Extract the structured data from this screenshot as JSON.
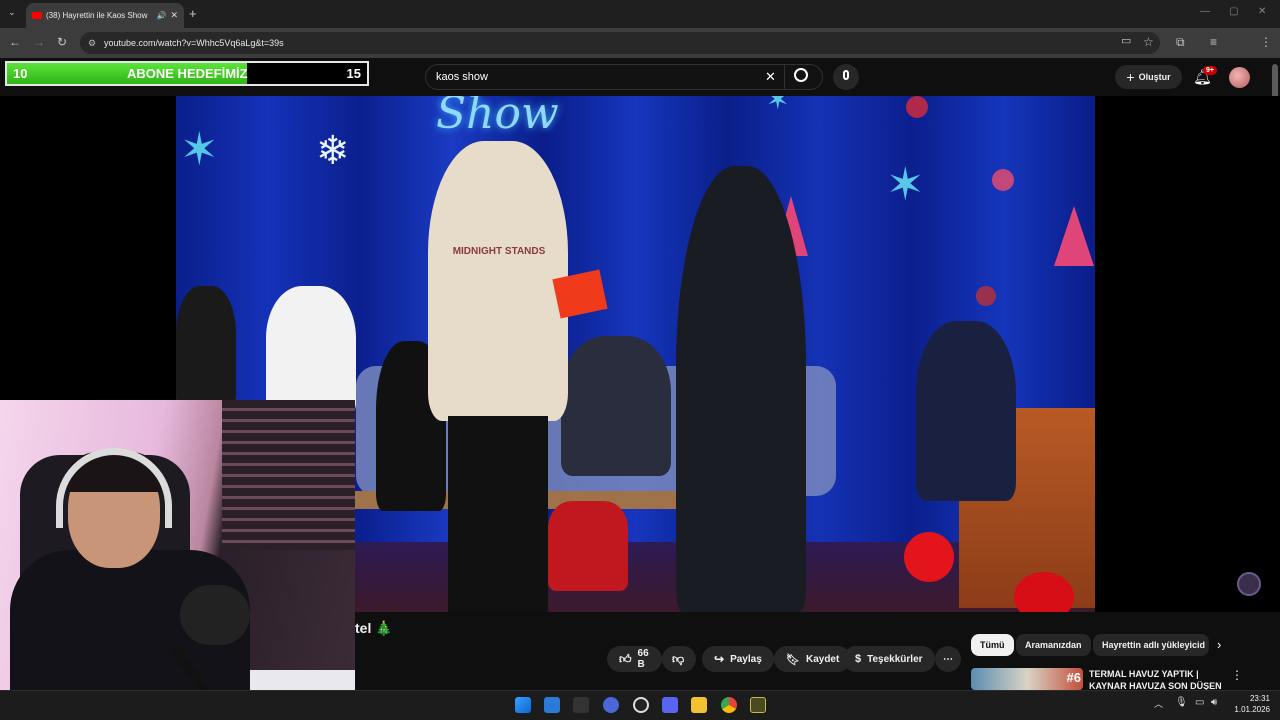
{
  "browser": {
    "tab_title": "(38) Hayrettin ile Kaos Show",
    "url": "youtube.com/watch?v=Whhc5Vq6aLg&t=39s",
    "new_tab_glyph": "+",
    "close_tab_glyph": "✕"
  },
  "overlay_goal": {
    "current": "10",
    "label": "ABONE HEDEFİMİZ",
    "target": "15",
    "progress_fraction": 0.667,
    "fill_color": "#4fd12a"
  },
  "header": {
    "search_value": "kaos show",
    "create_label": "Oluştur",
    "notification_badge": "9+"
  },
  "video": {
    "neon_sign": "Show",
    "sweater_text": "MIDNIGHT STANDS"
  },
  "below_video": {
    "title_fragment": "tel 🎄",
    "likes": "66 B",
    "share_label": "Paylaş",
    "save_label": "Kaydet",
    "thanks_label": "Teşekkürler",
    "more_glyph": "⋯"
  },
  "chips": [
    "Tümü",
    "Aramanızdan",
    "Hayrettin adlı yükleyicid"
  ],
  "recommendation": {
    "title_line1": "TERMAL HAVUZ YAPTIK |",
    "title_line2": "KAYNAR HAVUZA SON DÜŞEN",
    "badge": "#6"
  },
  "taskbar": {
    "time": "23:31",
    "date": "1.01.2026"
  },
  "colors": {
    "youtube_red": "#ff0000",
    "chrome_dark": "#1f1f1f",
    "stage_blue": "#1531b8"
  }
}
